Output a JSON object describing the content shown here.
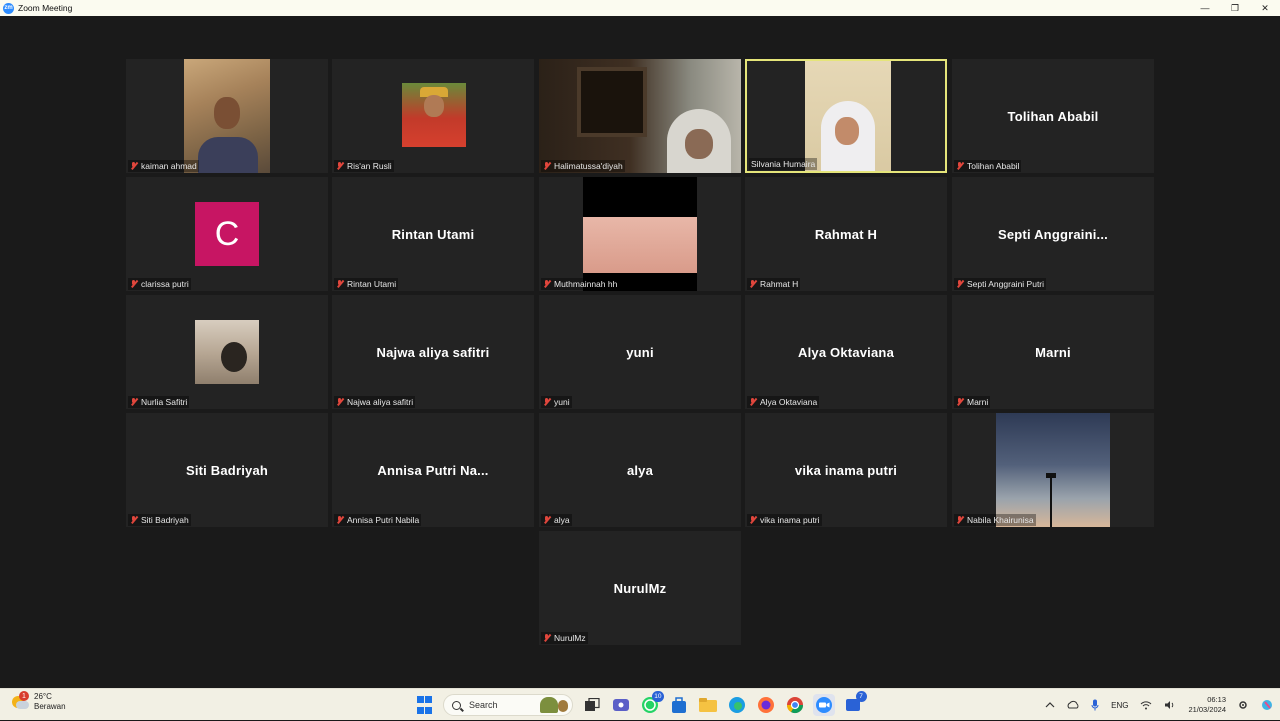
{
  "window": {
    "title": "Zoom Meeting",
    "app_icon": "zm",
    "controls": {
      "minimize": "—",
      "restore": "❐",
      "close": "✕"
    }
  },
  "participants": [
    {
      "label": "kaiman ahmad",
      "display": "video"
    },
    {
      "label": "Ris'an Rusli",
      "display": "video"
    },
    {
      "label": "Halimatussa'diyah",
      "display": "video"
    },
    {
      "label": "Silvania Humaira",
      "display": "video",
      "active_speaker": true
    },
    {
      "label": "Tolihan Ababil",
      "center_name": "Tolihan Ababil",
      "display": "name"
    },
    {
      "label": "clarissa putri",
      "avatar_letter": "C",
      "avatar_color": "#c71563",
      "display": "avatar"
    },
    {
      "label": "Rintan Utami",
      "center_name": "Rintan Utami",
      "display": "name"
    },
    {
      "label": "Muthmainnah hh",
      "display": "video"
    },
    {
      "label": "Rahmat H",
      "center_name": "Rahmat H",
      "display": "name"
    },
    {
      "label": "Septi Anggraini Putri",
      "center_name": "Septi  Anggraini...",
      "display": "name"
    },
    {
      "label": "Nurlia Safitri",
      "display": "video"
    },
    {
      "label": "Najwa aliya safitri",
      "center_name": "Najwa aliya safitri",
      "display": "name"
    },
    {
      "label": "yuni",
      "center_name": "yuni",
      "display": "name"
    },
    {
      "label": "Alya Oktaviana",
      "center_name": "Alya Oktaviana",
      "display": "name"
    },
    {
      "label": "Marni",
      "center_name": "Marni",
      "display": "name"
    },
    {
      "label": "Siti Badriyah",
      "center_name": "Siti Badriyah",
      "display": "name"
    },
    {
      "label": "Annisa Putri Nabila",
      "center_name": "Annisa  Putri  Na...",
      "display": "name"
    },
    {
      "label": "alya",
      "center_name": "alya",
      "display": "name"
    },
    {
      "label": "vika inama putri",
      "center_name": "vika inama putri",
      "display": "name"
    },
    {
      "label": "Nabila Khairunisa",
      "display": "video"
    },
    {
      "label": "NurulMz",
      "center_name": "NurulMz",
      "display": "name"
    }
  ],
  "taskbar": {
    "weather": {
      "temp": "26°C",
      "condition": "Berawan",
      "badge": "1"
    },
    "search_placeholder": "Search",
    "whatsapp_badge": "10",
    "store_badge": "7",
    "tray": {
      "lang": "ENG"
    },
    "clock": {
      "time": "06:13",
      "date": "21/03/2024"
    }
  },
  "colors": {
    "background": "#1a1a1a",
    "tile": "#232323",
    "active_border": "#e5e57a",
    "muted_mic": "#e0463c"
  }
}
